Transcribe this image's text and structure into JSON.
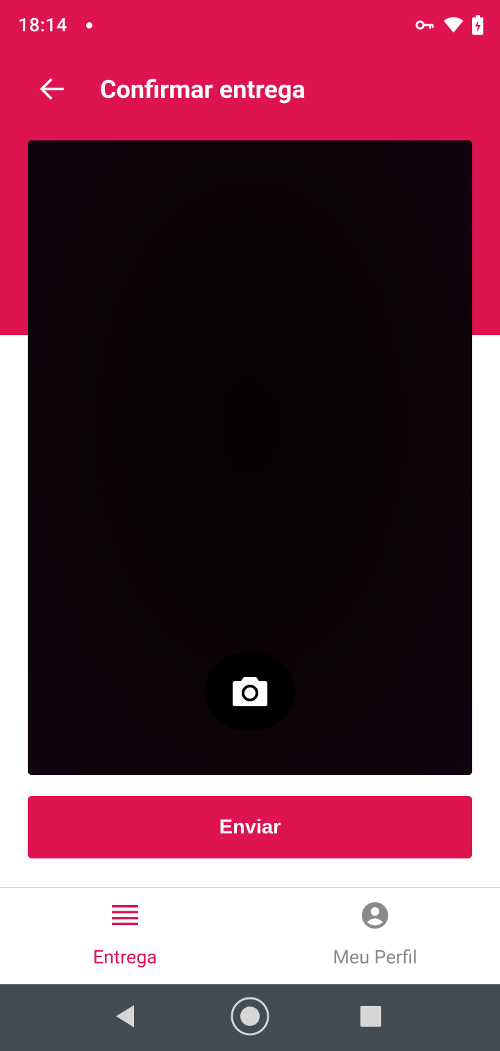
{
  "status_bar": {
    "time": "18:14"
  },
  "app_bar": {
    "title": "Confirmar entrega"
  },
  "actions": {
    "send_label": "Enviar"
  },
  "bottom_nav": {
    "items": [
      {
        "label": "Entrega",
        "icon": "list-icon",
        "active": true
      },
      {
        "label": "Meu Perfil",
        "icon": "account-circle-icon",
        "active": false
      }
    ]
  },
  "colors": {
    "primary": "#de1450",
    "system_nav": "#434c52",
    "inactive": "#8a8a8a"
  }
}
